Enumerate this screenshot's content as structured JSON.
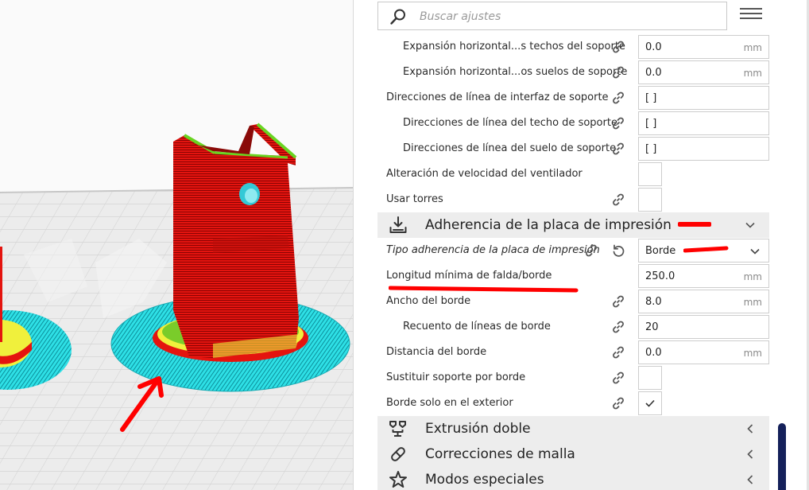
{
  "search": {
    "placeholder": "Buscar ajustes"
  },
  "settings_rows": [
    {
      "label": "Expansión horizontal...s techos del soporte",
      "value": "0.0",
      "unit": "mm"
    },
    {
      "label": "Expansión horizontal...os suelos de soporte",
      "value": "0.0",
      "unit": "mm"
    },
    {
      "label": "Direcciones de línea de interfaz de soporte",
      "value": "[ ]"
    },
    {
      "label": "Direcciones de línea del techo de soporte",
      "value": "[ ]"
    },
    {
      "label": "Direcciones de línea del suelo de soporte",
      "value": "[ ]"
    },
    {
      "label": "Alteración de velocidad del ventilador"
    },
    {
      "label": "Usar torres"
    }
  ],
  "adhesion_section": {
    "title": "Adherencia de la placa de impresión",
    "icon": "build-plate-download-icon",
    "rows": [
      {
        "label": "Tipo adherencia de la placa de impresión",
        "value": "Borde"
      },
      {
        "label": "Longitud mínima de falda/borde",
        "value": "250.0",
        "unit": "mm"
      },
      {
        "label": "Ancho del borde",
        "value": "8.0",
        "unit": "mm"
      },
      {
        "label": "Recuento de líneas de borde",
        "value": "20"
      },
      {
        "label": "Distancia del borde",
        "value": "0.0",
        "unit": "mm"
      },
      {
        "label": "Sustituir soporte por borde",
        "checked": false
      },
      {
        "label": "Borde solo en el exterior",
        "checked": true
      }
    ]
  },
  "collapsed_sections": [
    {
      "title": "Extrusión doble",
      "icon": "dual-extrusion-icon"
    },
    {
      "title": "Correcciones de malla",
      "icon": "mesh-fix-bandage-icon"
    },
    {
      "title": "Modos especiales",
      "icon": "special-modes-star-icon"
    }
  ],
  "colors": {
    "wall_red": "#e0120f",
    "brim_cyan": "#2ce0e6",
    "infill_yellow": "#f0f03c",
    "annotation_red": "#ff0000",
    "section_bg": "#ededed",
    "scrollbar": "#14205a"
  }
}
